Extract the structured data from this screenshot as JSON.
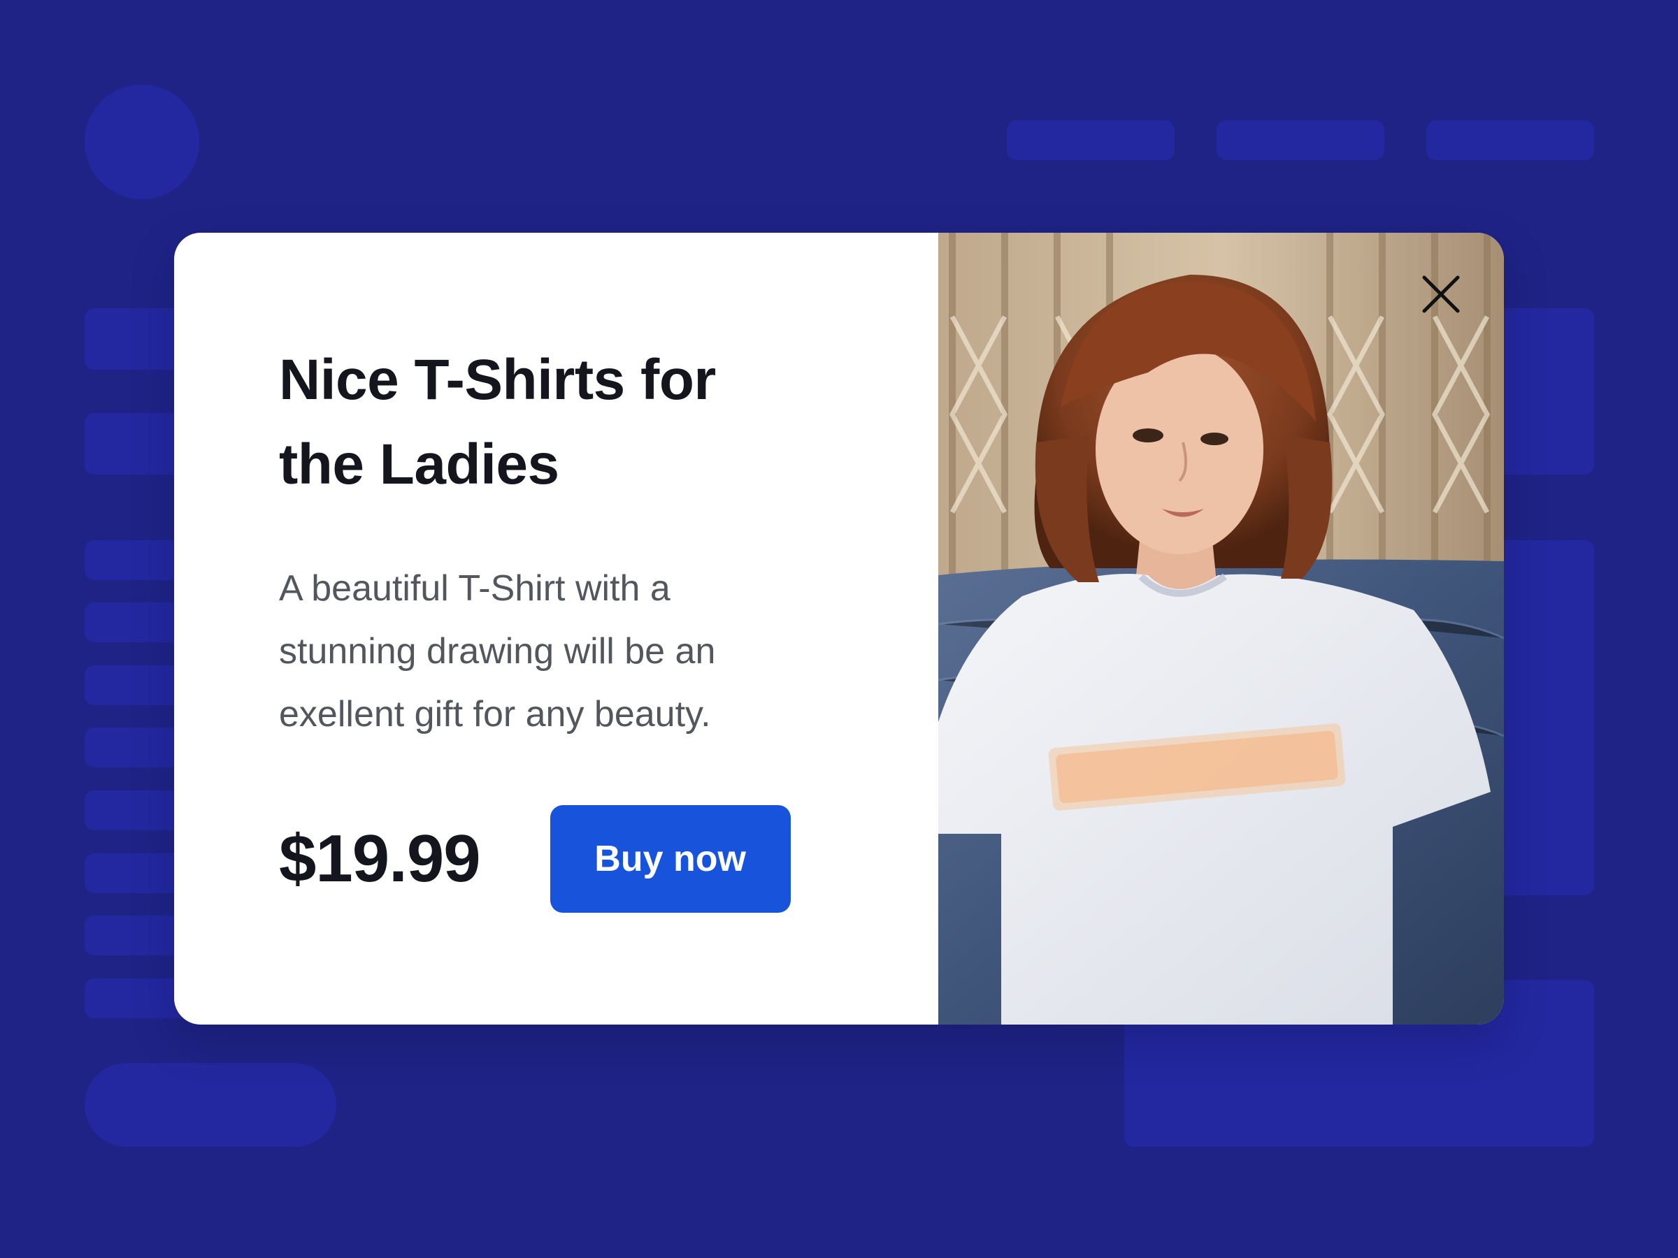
{
  "modal": {
    "title": "Nice T-Shirts for the Ladies",
    "description": "A beautiful T-Shirt with a stunning drawing will be an exellent gift for any beauty.",
    "price": "$19.99",
    "buy_button_label": "Buy now"
  },
  "icons": {
    "close": "close-icon"
  },
  "colors": {
    "page_background": "#1f2386",
    "skeleton": "#2328a0",
    "modal_background": "#ffffff",
    "accent": "#1753db",
    "title_text": "#15161d",
    "body_text": "#54565e"
  }
}
